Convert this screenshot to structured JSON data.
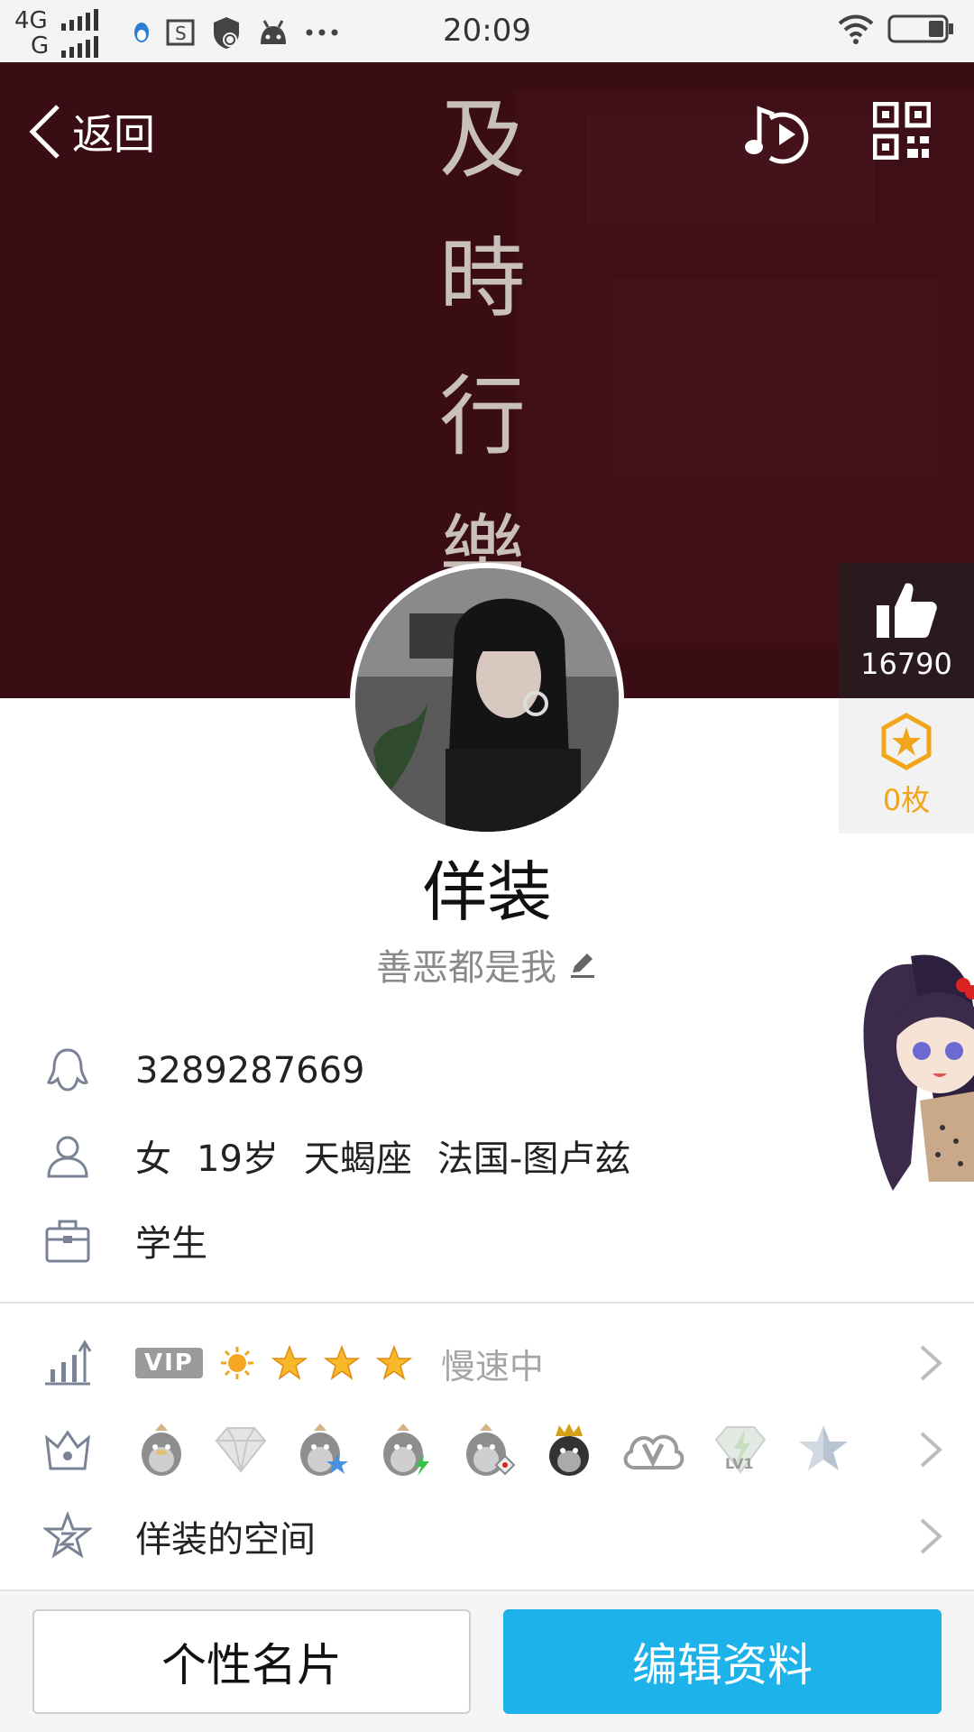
{
  "status_bar": {
    "network_top": "4G",
    "network_bottom": "G",
    "time": "20:09"
  },
  "header": {
    "back_label": "返回",
    "cover_text": [
      "及",
      "時",
      "行",
      "樂"
    ]
  },
  "side": {
    "like_count": "16790",
    "star_count": "0枚"
  },
  "profile": {
    "nickname": "佯装",
    "signature": "善恶都是我"
  },
  "info": {
    "qq_number": "3289287669",
    "gender": "女",
    "age": "19岁",
    "zodiac": "天蝎座",
    "location": "法国-图卢兹",
    "occupation": "学生"
  },
  "rows": {
    "vip_label": "VIP",
    "speed_text": "慢速中",
    "space_label": "佯装的空间",
    "lv_text": "LV1"
  },
  "buttons": {
    "card": "个性名片",
    "edit": "编辑资料"
  },
  "colors": {
    "cover_bg": "#3a0c13",
    "accent_blue": "#1eb2ea",
    "star_gold": "#f0a51a"
  }
}
